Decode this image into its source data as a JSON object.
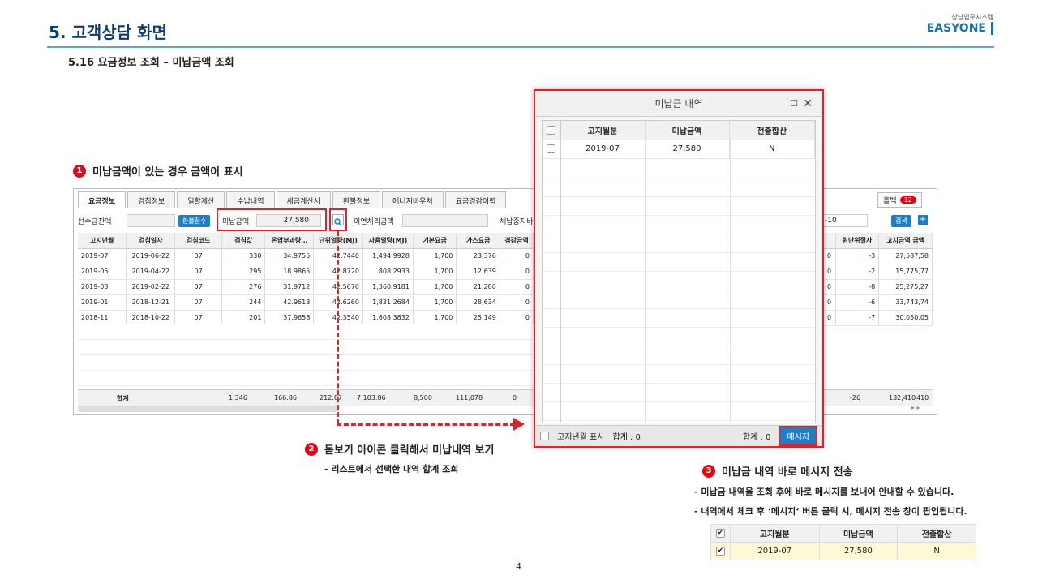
{
  "header": {
    "title": "5. 고객상담 화면",
    "subtitle": "5.16 요금정보 조회 – 미납금액 조회",
    "logo_sub": "상담업무시스템",
    "logo_main": "EASYONE"
  },
  "callouts": {
    "c1": {
      "num": "1",
      "text": "미납금액이 있는 경우 금액이 표시"
    },
    "c2": {
      "num": "2",
      "text": "돋보기 아이콘 클릭해서 미납내역 보기",
      "note": "- 리스트에서 선택한 내역 합계 조회"
    },
    "c3": {
      "num": "3",
      "text": "미납금 내역 바로 메시지 전송",
      "note1": "-   미납금 내역을 조회 후에 바로 메시지를 보내어 안내할 수 있습니다.",
      "note2": "-   내역에서 체크 후 ‘메시지‘ 버튼 클릭 시, 메시지 전송 창이 팝업됩니다."
    }
  },
  "tabs": [
    "요금정보",
    "검침정보",
    "일할계산",
    "수납내역",
    "세금계산서",
    "환불정보",
    "에너지바우처",
    "요금경감이력"
  ],
  "memo": {
    "label": "홀백",
    "count": "12"
  },
  "filter": {
    "prepay_label": "선수금잔액",
    "refund_btn": "환불접수",
    "unpaid_label": "미납금액",
    "unpaid_value": "27,580",
    "carry_label": "이연처리금액",
    "arrears_label": "체납중지바",
    "date_value": "-10",
    "search_btn": "검색",
    "plus": "+"
  },
  "grid": {
    "columns": [
      "고지년월",
      "검침일자",
      "검침코드",
      "검침값",
      "온압부과량…",
      "단위열량(MJ)",
      "사용열량(MJ)",
      "기본요금",
      "가스요금",
      "경감금액"
    ],
    "rows": [
      [
        "2019-07",
        "2019-06-22",
        "07",
        "330",
        "34.9755",
        "42.7440",
        "1,494.9928",
        "1,700",
        "23,376",
        "0"
      ],
      [
        "2019-05",
        "2019-04-22",
        "07",
        "295",
        "18.9865",
        "42.8720",
        "808.2933",
        "1,700",
        "12,639",
        "0"
      ],
      [
        "2019-03",
        "2019-02-22",
        "07",
        "276",
        "31.9712",
        "42.5670",
        "1,360.9181",
        "1,700",
        "21,280",
        "0"
      ],
      [
        "2019-01",
        "2018-12-21",
        "07",
        "244",
        "42.9613",
        "42.6260",
        "1,831.2684",
        "1,700",
        "28,634",
        "0"
      ],
      [
        "2018-11",
        "2018-10-22",
        "07",
        "201",
        "37.9658",
        "42.3540",
        "1,608.3832",
        "1,700",
        "25,149",
        "0"
      ]
    ],
    "sum_label": "합계",
    "sums": [
      "1,346",
      "166.86",
      "212.87",
      "7,103.86",
      "8,500",
      "111,078",
      "0"
    ],
    "right_columns": [
      "원단위절사",
      "고지금액 금액"
    ],
    "right_rows": [
      [
        "0",
        "-3",
        "27,58",
        "7,58"
      ],
      [
        "0",
        "-2",
        "15,77",
        "5,77"
      ],
      [
        "0",
        "-8",
        "25,27",
        "5,27"
      ],
      [
        "0",
        "-6",
        "33,74",
        "3,74"
      ],
      [
        "0",
        "-7",
        "30,05",
        "0,05"
      ]
    ],
    "right_sums": [
      "-26",
      "132,410",
      "410"
    ]
  },
  "modal": {
    "title": "미납금 내역",
    "columns": [
      "고지월분",
      "미납금액",
      "전출합산"
    ],
    "rows": [
      [
        "2019-07",
        "27,580",
        "N"
      ]
    ],
    "foot_checkbox": "고지년월 표시",
    "sum1": "합계 : 0",
    "sum2": "합계 : 0",
    "send_btn": "메시지"
  },
  "small_table": {
    "columns": [
      "고지월분",
      "미납금액",
      "전출합산"
    ],
    "row": [
      "2019-07",
      "27,580",
      "N"
    ]
  },
  "page_number": "4"
}
